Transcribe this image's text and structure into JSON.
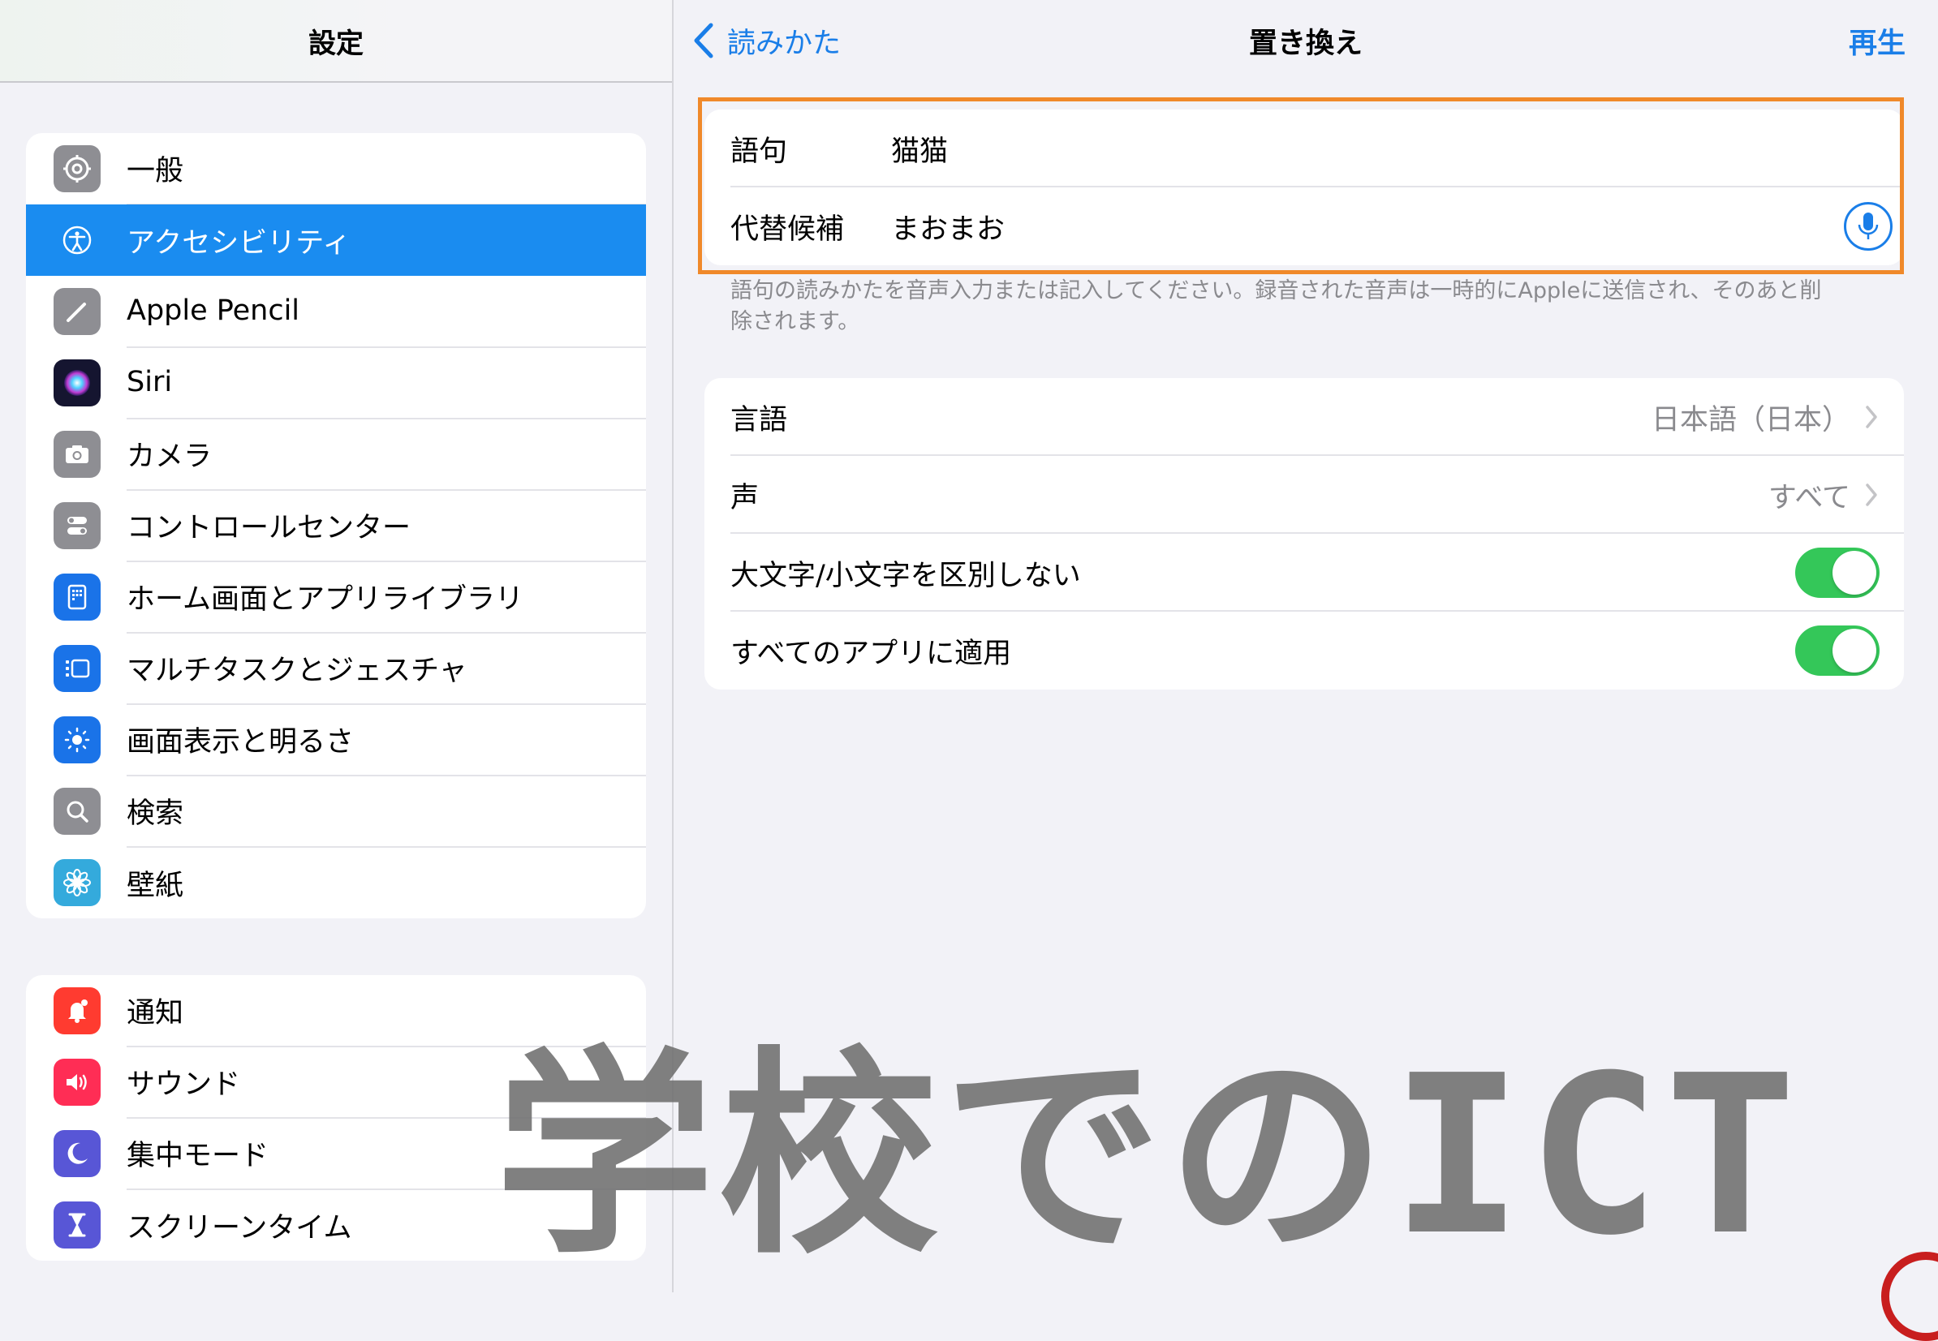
{
  "sidebar": {
    "title": "設定",
    "group1": [
      {
        "label": "一般",
        "icon": "gear-icon",
        "color": "#8e8e93"
      },
      {
        "label": "アクセシビリティ",
        "icon": "accessibility-icon",
        "color": "#1a8cf0"
      },
      {
        "label": "Apple Pencil",
        "icon": "pencil-icon",
        "color": "#8e8e93"
      },
      {
        "label": "Siri",
        "icon": "siri-icon",
        "color": "#2b2b5a"
      },
      {
        "label": "カメラ",
        "icon": "camera-icon",
        "color": "#8e8e93"
      },
      {
        "label": "コントロールセンター",
        "icon": "control-center-icon",
        "color": "#8e8e93"
      },
      {
        "label": "ホーム画面とアプリライブラリ",
        "icon": "home-screen-icon",
        "color": "#1a73e8"
      },
      {
        "label": "マルチタスクとジェスチャ",
        "icon": "multitask-icon",
        "color": "#1a73e8"
      },
      {
        "label": "画面表示と明るさ",
        "icon": "brightness-icon",
        "color": "#1a73e8"
      },
      {
        "label": "検索",
        "icon": "search-icon",
        "color": "#8e8e93"
      },
      {
        "label": "壁紙",
        "icon": "wallpaper-icon",
        "color": "#34aadc"
      }
    ],
    "group2": [
      {
        "label": "通知",
        "icon": "bell-icon",
        "color": "#ff3b30"
      },
      {
        "label": "サウンド",
        "icon": "speaker-icon",
        "color": "#ff2d55"
      },
      {
        "label": "集中モード",
        "icon": "moon-icon",
        "color": "#5856d6"
      },
      {
        "label": "スクリーンタイム",
        "icon": "hourglass-icon",
        "color": "#5856d6"
      }
    ]
  },
  "detail": {
    "back_label": "読みかた",
    "title": "置き換え",
    "play_label": "再生",
    "phrase_key": "語句",
    "phrase_value": "猫猫",
    "substitute_key": "代替候補",
    "substitute_value": "まおまお",
    "footnote": "語句の読みかたを音声入力または記入してください。録音された音声は一時的にAppleに送信され、そのあと削除されます。",
    "language_label": "言語",
    "language_value": "日本語（日本）",
    "voice_label": "声",
    "voice_value": "すべて",
    "ignore_case_label": "大文字/小文字を区別しない",
    "ignore_case_on": true,
    "all_apps_label": "すべてのアプリに適用",
    "all_apps_on": true
  },
  "colors": {
    "accent": "#1a7ee8",
    "highlight_border": "#f0892a",
    "toggle_on": "#34c759"
  },
  "watermark": "学校でのICT"
}
